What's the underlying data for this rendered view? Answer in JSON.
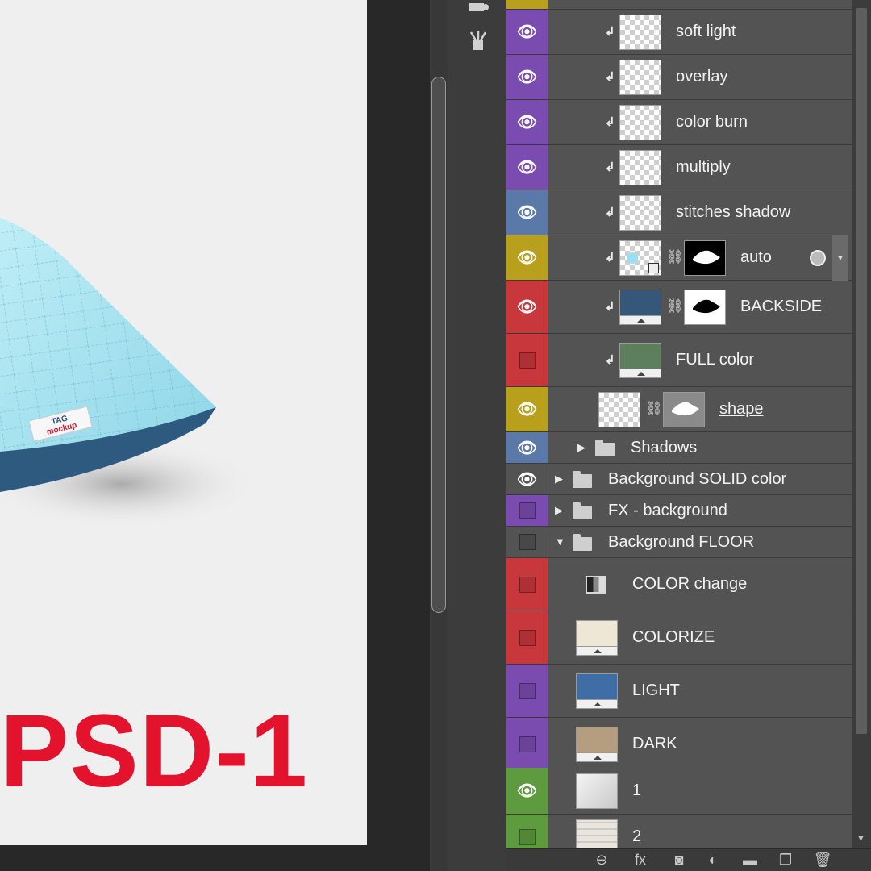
{
  "canvas": {
    "title_text": "PSD-1",
    "tag_label_line1": "TAG",
    "tag_label_line2": "mockup",
    "title_color": "#e4132d"
  },
  "tools": [
    {
      "icon": "brush-tool-icon"
    },
    {
      "icon": "adjustment-brushes-icon"
    }
  ],
  "layers": [
    {
      "name": "soft light",
      "visible": true,
      "color": "#7a4cb0",
      "clipped": true,
      "thumb": "checker"
    },
    {
      "name": "overlay",
      "visible": true,
      "color": "#7a4cb0",
      "clipped": true,
      "thumb": "checker"
    },
    {
      "name": "color burn",
      "visible": true,
      "color": "#7a4cb0",
      "clipped": true,
      "thumb": "checker"
    },
    {
      "name": "multiply",
      "visible": true,
      "color": "#7a4cb0",
      "clipped": true,
      "thumb": "checker"
    },
    {
      "name": "stitches shadow",
      "visible": true,
      "color": "#5a78a8",
      "clipped": true,
      "thumb": "checker"
    },
    {
      "name": "auto",
      "visible": true,
      "color": "#b8a01c",
      "clipped": true,
      "thumb": "smart",
      "mask": true
    },
    {
      "name": "BACKSIDE",
      "visible": true,
      "color": "#c8373c",
      "clipped": true,
      "thumb": "fill",
      "fill": "#35577a",
      "mask": true
    },
    {
      "name": "FULL color",
      "visible": false,
      "color": "#c8373c",
      "clipped": true,
      "thumb": "fill",
      "fill": "#5e7f5c"
    },
    {
      "name": "shape",
      "visible": true,
      "color": "#b8a01c",
      "clipped": false,
      "thumb": "checker",
      "mask": true
    },
    {
      "name": "Shadows",
      "visible": true,
      "color": "#5a78a8",
      "group": true,
      "expanded": false
    },
    {
      "name": "Background SOLID color",
      "visible": true,
      "color": "#535353",
      "group": true,
      "expanded": false
    },
    {
      "name": "FX - background",
      "visible": false,
      "color": "#7a4cb0",
      "group": true,
      "expanded": false
    },
    {
      "name": "Background FLOOR",
      "visible": false,
      "color": "#535353",
      "group": true,
      "expanded": true
    },
    {
      "name": "COLOR change",
      "visible": false,
      "color": "#c8373c",
      "thumb": "adjustment"
    },
    {
      "name": "COLORIZE",
      "visible": false,
      "color": "#c8373c",
      "thumb": "fill",
      "fill": "#efe7d6"
    },
    {
      "name": "LIGHT",
      "visible": false,
      "color": "#7a4cb0",
      "thumb": "fill",
      "fill": "#3f6ea6"
    },
    {
      "name": "DARK",
      "visible": false,
      "color": "#7a4cb0",
      "thumb": "fill",
      "fill": "#b59d80"
    },
    {
      "name": "1",
      "visible": true,
      "color": "#5e9a3e",
      "thumb": "texture"
    },
    {
      "name": "2",
      "visible": false,
      "color": "#5e9a3e",
      "thumb": "texture2"
    }
  ],
  "bottom_bar": [
    {
      "icon": "link-layers-icon",
      "glyph": "⊖"
    },
    {
      "icon": "fx-icon",
      "glyph": "fx"
    },
    {
      "icon": "add-mask-icon",
      "glyph": "◙"
    },
    {
      "icon": "adjustment-layer-icon",
      "glyph": "◐"
    },
    {
      "icon": "new-group-icon",
      "glyph": "▬"
    },
    {
      "icon": "new-layer-icon",
      "glyph": "❐"
    },
    {
      "icon": "trash-icon",
      "glyph": "🗑"
    }
  ]
}
